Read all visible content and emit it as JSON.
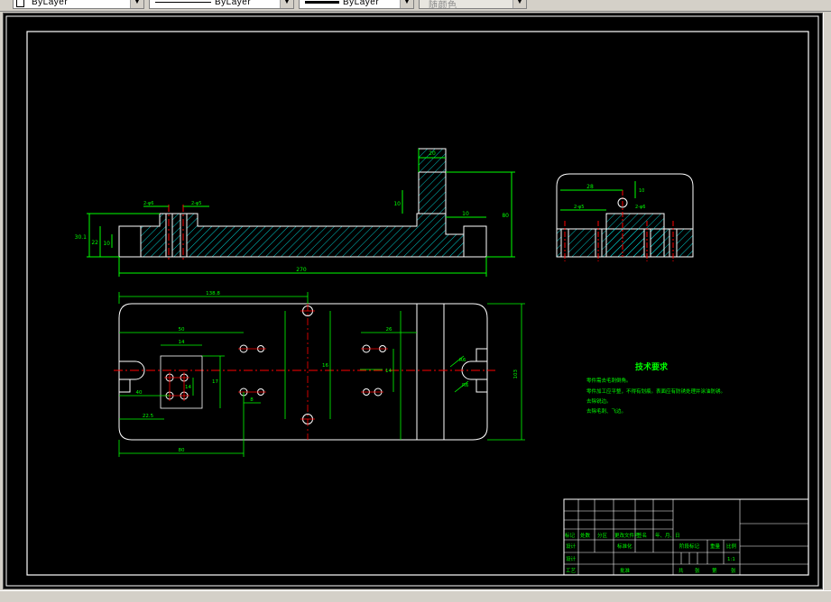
{
  "toolbar": {
    "layer": {
      "label": "ByLayer"
    },
    "linetype": {
      "label": "ByLayer"
    },
    "lineweight": {
      "label": "ByLayer"
    },
    "plotstyle": {
      "label": "随颜色"
    }
  },
  "drawing": {
    "dims": {
      "overall_length": "270",
      "total_height": "80",
      "left_height": "30.1",
      "left_small": "22",
      "step": "10",
      "top_boss_width": "20",
      "top_boss_height": "10",
      "hole_callout_left": "2-φ6",
      "hole_callout_right": "2-φ5",
      "plan_half_length": "138.8",
      "plan_width": "103",
      "side_dim_a": "28",
      "side_dim_b": "10",
      "side_dim_c": "2-φ5",
      "side_dim_d": "2-φ6",
      "slot_r": "R6",
      "slot_r2": "R6",
      "plan_dim_1": "80",
      "plan_dim_2": "50",
      "plan_dim_3": "14",
      "plan_dim_4": "40",
      "plan_dim_5": "14",
      "plan_dim_6": "17",
      "plan_dim_7": "22.5",
      "plan_dim_8": "8",
      "plan_dim_9": "16",
      "plan_dim_10": "26",
      "plan_dim_11": "14"
    },
    "tech": {
      "title": "技术要求",
      "items": [
        "零件需去毛刺倒角。",
        "零件加工应平整，不得有划痕。表面应有防锈处理并涂油防锈。",
        "去除锐边。",
        "去除毛刺、飞边。"
      ]
    },
    "title_block": {
      "row_labels": [
        "标记",
        "处数",
        "分区",
        "更改文件号",
        "签名",
        "年、月、日"
      ],
      "design": "设计",
      "standard": "标准化",
      "process": "工艺",
      "approve": "批准",
      "stage_mark": "阶段标记",
      "weight": "重量",
      "scale_label": "比例",
      "scale": "1:1",
      "sheet_total": "共",
      "sheet_label": "张",
      "sheet_no": "第",
      "sheet_label2": "张"
    }
  },
  "colors": {
    "canvas_bg": "#000000",
    "outline": "#ffffff",
    "dimension": "#00ff00",
    "center_line": "#ff0000",
    "hatch": "#00ffff",
    "text_green": "#00ff00",
    "tech_title": "#00ff00"
  }
}
